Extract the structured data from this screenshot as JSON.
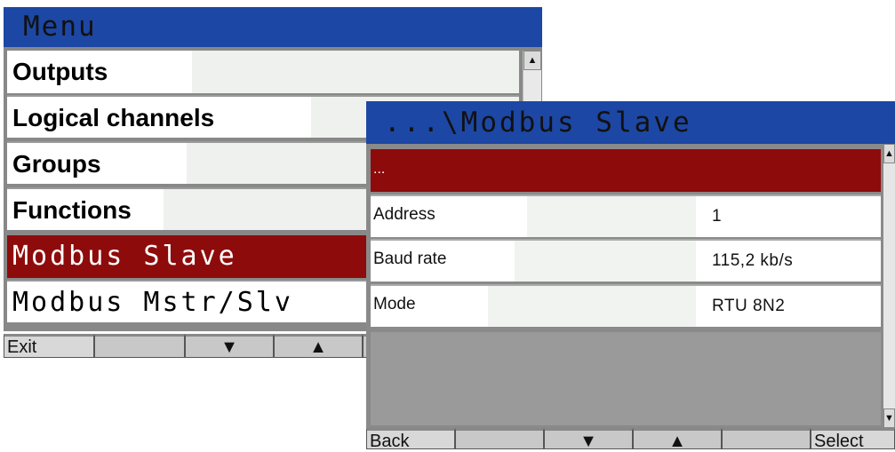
{
  "menu": {
    "title": "Menu",
    "items": [
      {
        "label": "Outputs"
      },
      {
        "label": "Logical channels"
      },
      {
        "label": "Groups"
      },
      {
        "label": "Functions"
      },
      {
        "label": "Modbus  Slave"
      },
      {
        "label": "Modbus  Mstr/Slv"
      }
    ],
    "softkeys": {
      "exit": "Exit",
      "down": "▼",
      "up": "▲"
    }
  },
  "submenu": {
    "title": "...\\Modbus  Slave",
    "back_row": "...",
    "rows": [
      {
        "name": "Address",
        "value": "1"
      },
      {
        "name": "Baud rate",
        "value": "115,2 kb/s"
      },
      {
        "name": "Mode",
        "value": "RTU 8N2"
      }
    ],
    "softkeys": {
      "back": "Back",
      "down": "▼",
      "up": "▲",
      "select": "Select"
    }
  },
  "colors": {
    "title_bar": "#1d47a4",
    "selection": "#8e0b0b"
  },
  "icons": {
    "scroll_up": "▲",
    "scroll_down": "▼"
  }
}
